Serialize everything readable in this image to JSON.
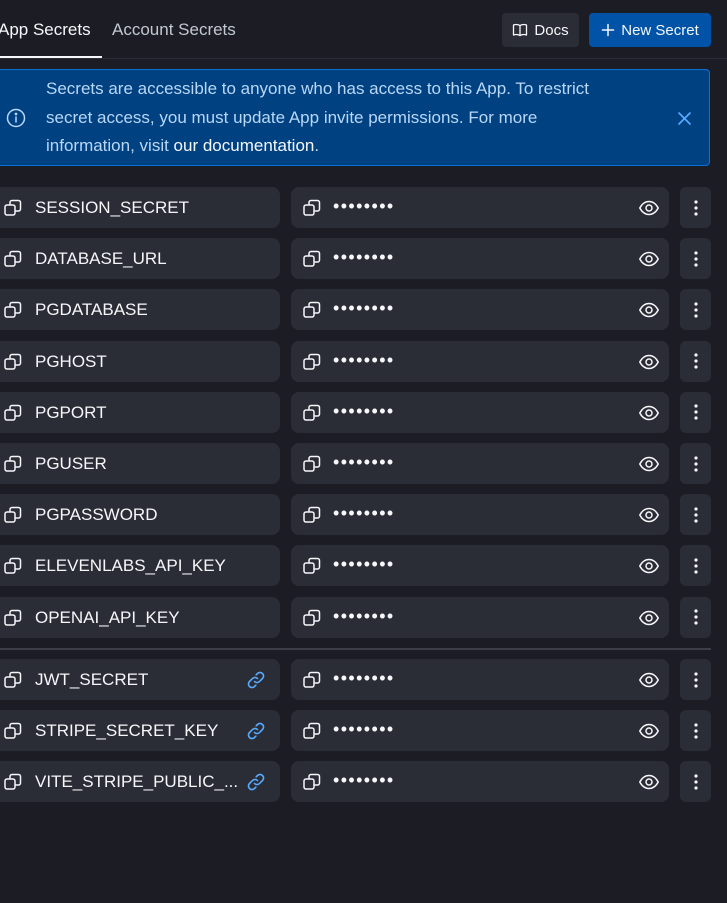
{
  "tabs": [
    {
      "label": "App Secrets",
      "active": true
    },
    {
      "label": "Account Secrets",
      "active": false
    }
  ],
  "toolbar": {
    "docs_label": "Docs",
    "new_secret_label": "New Secret"
  },
  "banner": {
    "text_before": "Secrets are accessible to anyone who has access to this App. To restrict secret access, you must update App invite permissions. For more information, visit ",
    "link_text": "our documentation",
    "text_after": "."
  },
  "masked_value": "••••••••",
  "secrets": [
    {
      "key": "SESSION_SECRET",
      "linked": false
    },
    {
      "key": "DATABASE_URL",
      "linked": false
    },
    {
      "key": "PGDATABASE",
      "linked": false
    },
    {
      "key": "PGHOST",
      "linked": false
    },
    {
      "key": "PGPORT",
      "linked": false
    },
    {
      "key": "PGUSER",
      "linked": false
    },
    {
      "key": "PGPASSWORD",
      "linked": false
    },
    {
      "key": "ELEVENLABS_API_KEY",
      "linked": false
    },
    {
      "key": "OPENAI_API_KEY",
      "linked": false
    }
  ],
  "account_secrets": [
    {
      "key": "JWT_SECRET",
      "linked": true
    },
    {
      "key": "STRIPE_SECRET_KEY",
      "linked": true
    },
    {
      "key": "VITE_STRIPE_PUBLIC_...",
      "linked": true
    }
  ],
  "icons": {
    "docs": "book-icon",
    "new_secret": "plus-icon",
    "info": "info-circle-icon",
    "close": "close-icon",
    "copy": "copy-icon",
    "link": "link-icon",
    "reveal": "eye-icon",
    "more": "more-vertical-icon"
  },
  "colors": {
    "background": "#1c1d24",
    "surface": "#2b2d36",
    "primary_button": "#0053a6",
    "banner_bg": "#004182",
    "banner_border": "#0c6fd3",
    "banner_text": "#b9d7f7",
    "link_icon": "#57abff",
    "text": "#f5f7fa"
  }
}
